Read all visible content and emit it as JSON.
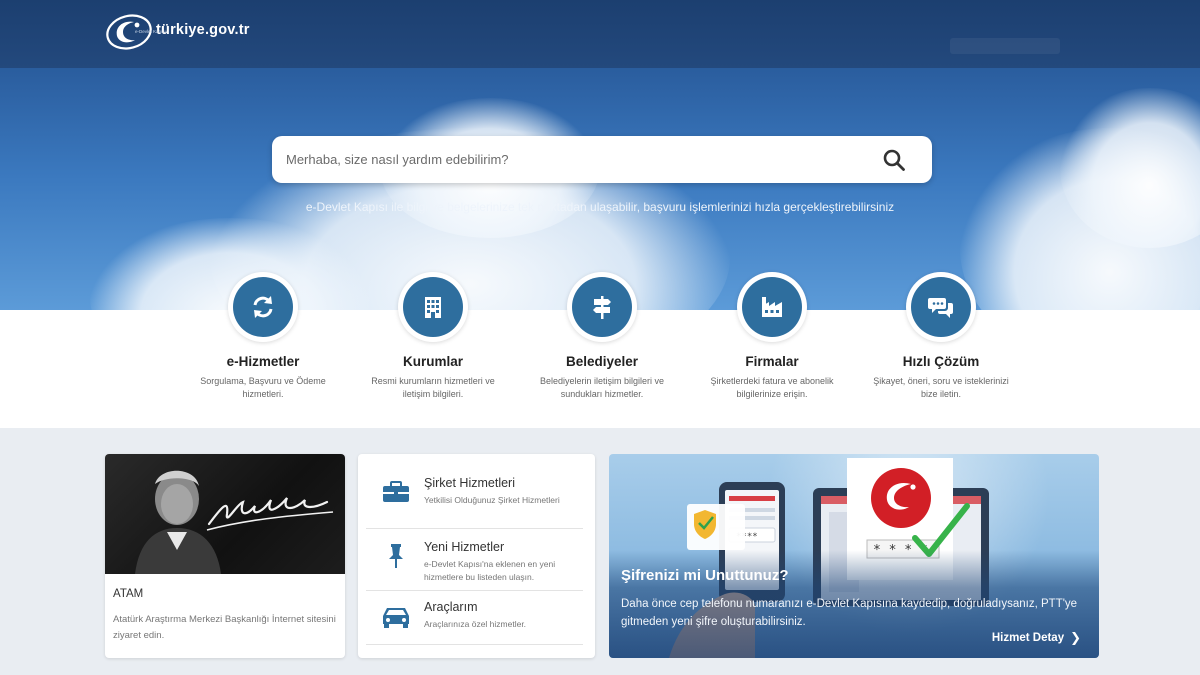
{
  "header": {
    "logo_text": "türkiye.gov.tr",
    "tagline": "e-Devlet Kapısı"
  },
  "hero": {
    "search_placeholder": "Merhaba, size nasıl yardım edebilirim?",
    "subtitle": "e-Devlet Kapısı ile bilgi ve belgelerinize tek noktadan ulaşabilir, başvuru işlemlerinizi hızla gerçekleştirebilirsiniz"
  },
  "categories": [
    {
      "title": "e-Hizmetler",
      "desc": "Sorgulama, Başvuru ve Ödeme hizmetleri.",
      "icon": "refresh-icon"
    },
    {
      "title": "Kurumlar",
      "desc": "Resmi kurumların hizmetleri ve iletişim bilgileri.",
      "icon": "building-icon"
    },
    {
      "title": "Belediyeler",
      "desc": "Belediyelerin iletişim bilgileri ve sundukları hizmetler.",
      "icon": "signpost-icon"
    },
    {
      "title": "Firmalar",
      "desc": "Şirketlerdeki fatura ve abonelik bilgilerinize erişin.",
      "icon": "factory-icon"
    },
    {
      "title": "Hızlı Çözüm",
      "desc": "Şikayet, öneri, soru ve isteklerinizi bize iletin.",
      "icon": "chat-icon"
    }
  ],
  "atam": {
    "title": "ATAM",
    "desc": "Atatürk Araştırma Merkezi Başkanlığı İnternet sitesini ziyaret edin.",
    "signature": "K. Atatürk"
  },
  "services": [
    {
      "title": "Şirket Hizmetleri",
      "desc": "Yetkilisi Olduğunuz Şirket Hizmetleri",
      "icon": "briefcase-icon"
    },
    {
      "title": "Yeni Hizmetler",
      "desc": "e-Devlet Kapısı'na eklenen en yeni hizmetlere bu listeden ulaşın.",
      "icon": "pin-icon"
    },
    {
      "title": "Araçlarım",
      "desc": "Araçlarınıza özel hizmetler.",
      "icon": "car-icon"
    }
  ],
  "promo": {
    "title": "Şifrenizi mi Unuttunuz?",
    "desc": "Daha önce cep telefonu numaranızı e-Devlet Kapısına kaydedip, doğruladıysanız, PTT'ye gitmeden yeni şifre oluşturabilirsiniz.",
    "link": "Hizmet Detay",
    "password_mask": "****"
  },
  "colors": {
    "header_bg": "#1c3f70",
    "accent": "#2e6e9e",
    "brand_red": "#d21f26"
  }
}
